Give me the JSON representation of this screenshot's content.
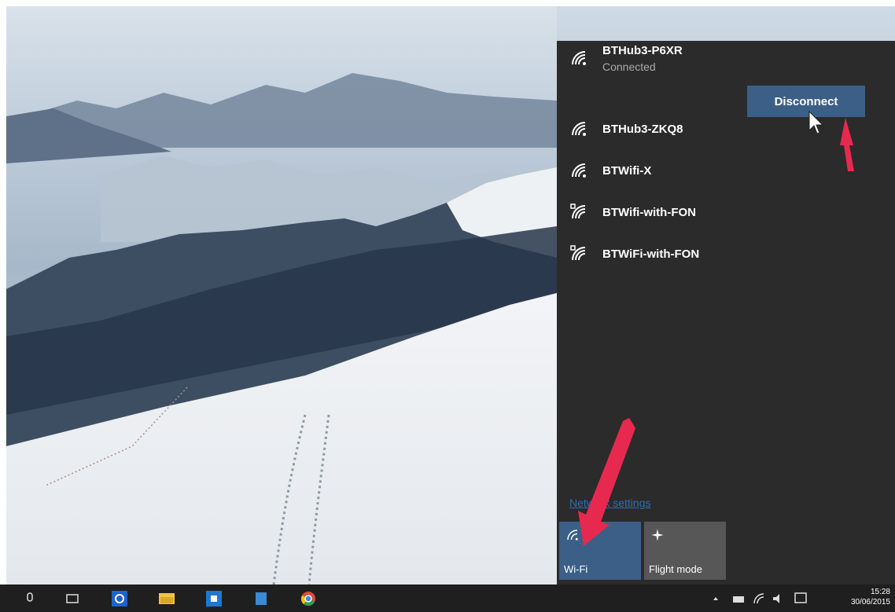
{
  "desktop": {
    "description_hidden": ""
  },
  "networks": {
    "connected": {
      "name": "BTHub3-P6XR",
      "status": "Connected",
      "action": "Disconnect"
    },
    "items": [
      {
        "name": "BTHub3-ZKQ8"
      },
      {
        "name": "BTWifi-X"
      },
      {
        "name": "BTWifi-with-FON"
      },
      {
        "name": "BTWiFi-with-FON"
      }
    ],
    "settings_link": "Network settings"
  },
  "quick_actions": {
    "wifi": {
      "label": "Wi-Fi",
      "active": true
    },
    "flight": {
      "label": "Flight mode",
      "active": false
    }
  },
  "taskbar": {
    "time": "15:28",
    "date": "30/06/2015"
  },
  "colors": {
    "panel_bg": "#2b2b2b",
    "accent": "#3c5f87",
    "annotation_arrow": "#e8294f"
  }
}
